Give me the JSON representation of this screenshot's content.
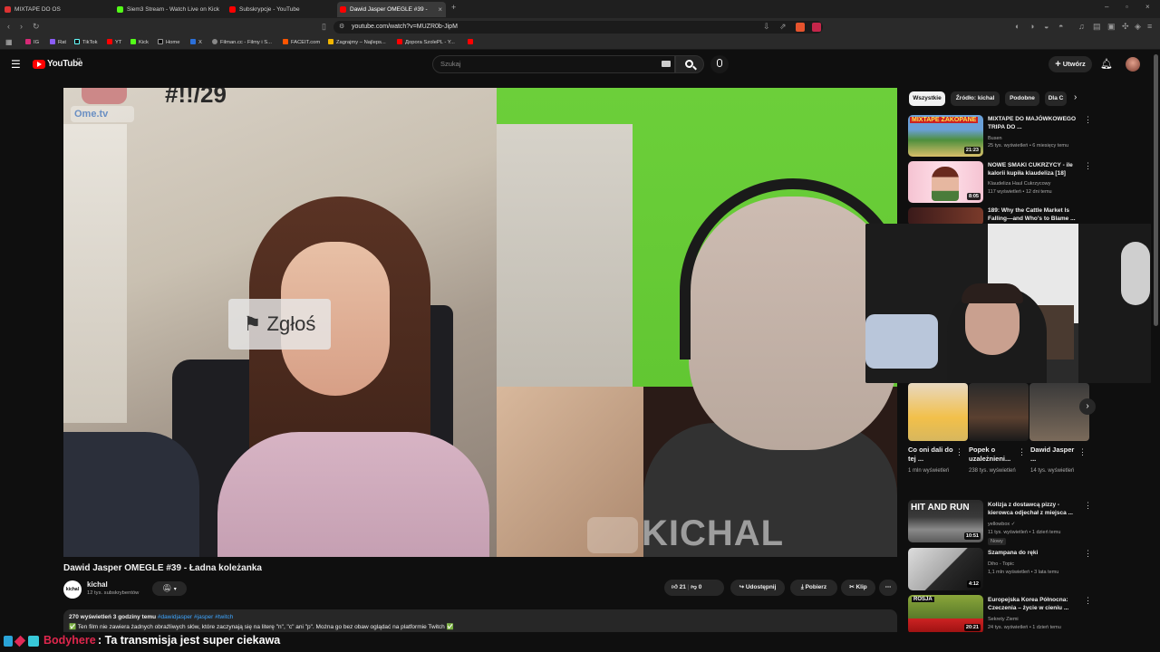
{
  "browser": {
    "tabs": [
      {
        "label": "MIXTAPE DO OS",
        "color": "#d33"
      },
      {
        "label": "Siem3 Stream - Watch Live on Kick",
        "color": "#53fc18"
      },
      {
        "label": "Subskrypcje - YouTube",
        "color": "#f00"
      },
      {
        "label": "Dawid Jasper OMEGLE #39 -",
        "color": "#f00"
      }
    ],
    "url": "youtube.com/watch?v=MUZR0b-JipM",
    "bookmarks": [
      "IG",
      "Rat",
      "TikTok",
      "YT",
      "Kick",
      "Home",
      "X",
      "Filman.cc - Filmy i S...",
      "FACEIT.com",
      "Zagrajmy – Najleps...",
      "Доpora SzolePL - Y..."
    ]
  },
  "youtube": {
    "logo_text": "YouTube",
    "logo_region": "PL",
    "search_placeholder": "Szukaj",
    "create_label": "Utwórz"
  },
  "video": {
    "overlay_topleft": "Ome.tv",
    "overlay_topnum": "#!!/29",
    "report_label": "Zgłoś",
    "watermark": "KICHAL",
    "title": "Dawid Jasper OMEGLE #39 - Ładna koleżanka",
    "channel": "kichal",
    "channel_avatar_text": "kichal",
    "subscribers": "12 tys. subskrybentów",
    "likes": "21",
    "dislikes": "0",
    "share": "Udostępnij",
    "download": "Pobierz",
    "clip": "Klip",
    "desc_meta": "270 wyświetleń  3 godziny temu",
    "desc_tags": "#dawidjasper #jasper #twitch",
    "desc_text": "✅ Ten film nie zawiera żadnych obraźliwych słów, które zaczynają się na literę \"n\", \"c\" ani \"p\". Można go bez obaw oglądać na platformie Twitch ✅"
  },
  "sidebar": {
    "chips": [
      "Wszystkie",
      "Źródło: kichal",
      "Podobne",
      "Dla C"
    ],
    "videos": [
      {
        "title": "MIXTAPE DO MAJÓWKOWEGO TRIPA DO ...",
        "channel": "Busen",
        "meta": "25 tys. wyświetleń • 6 miesięcy temu",
        "duration": "21:23",
        "thumb_text": "MIXTAPE ZAKOPANE"
      },
      {
        "title": "NOWE SMAKI CUKRZYCY - ile kalorii kupiła klaudeliza [18]",
        "channel": "Klaudeliza Haul Cukrzycowy",
        "meta": "117 wyświetleń • 12 dni temu",
        "duration": "8:05"
      },
      {
        "title": "189: Why the Cattle Market Is Falling—and Who's to Blame ...",
        "channel": "",
        "meta": "",
        "duration": ""
      }
    ],
    "shorts": [
      {
        "title": "Co oni dali do tej ...",
        "meta": "1 mln wyświetleń"
      },
      {
        "title": "Popek o uzależnieni...",
        "meta": "238 tys. wyświetleń"
      },
      {
        "title": "Dawid Jasper ...",
        "meta": "14 tys. wyświetleń"
      }
    ],
    "videos2": [
      {
        "title": "Kolizja z dostawcą pizzy - kierowca odjechał z miejsca ...",
        "channel": "yellowbox",
        "meta": "11 tys. wyświetleń • 1 dzień temu",
        "badge": "Nowy",
        "duration": "10:51",
        "thumb_text": "HIT AND RUN"
      },
      {
        "title": "Szampana do ręki",
        "channel": "Diho - Topic",
        "meta": "1,1 mln wyświetleń • 3 lata temu",
        "duration": "4:12"
      },
      {
        "title": "Europejska Korea Północna: Czeczenia – życie w cieniu ...",
        "channel": "Sekrety Ziemi",
        "meta": "24 tys. wyświetleń • 1 dzień temu",
        "duration": "20:21",
        "thumb_text": "ROSJA"
      }
    ]
  },
  "chat": {
    "user": "Bodyhere",
    "message": ": Ta transmisja jest super ciekawa"
  }
}
